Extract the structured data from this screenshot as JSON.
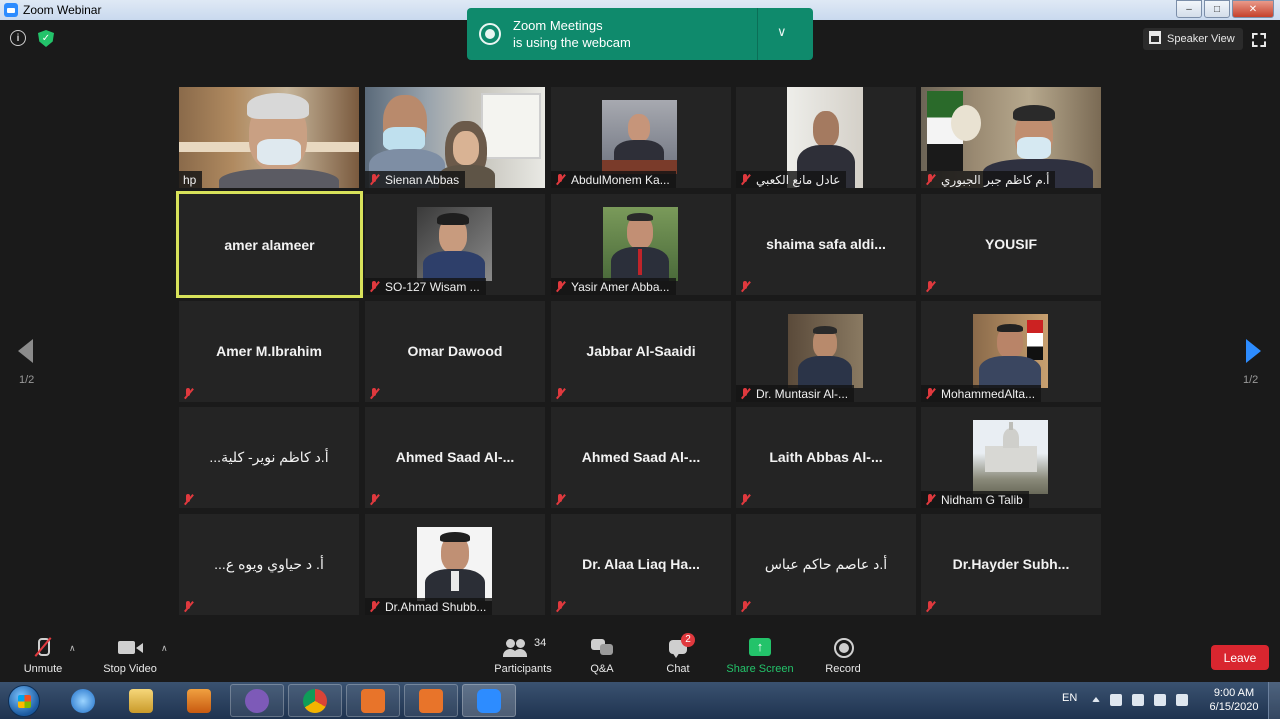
{
  "window": {
    "title": "Zoom Webinar"
  },
  "notification": {
    "line1": "Zoom Meetings",
    "line2": "is using the webcam"
  },
  "view": {
    "speaker_view_label": "Speaker View"
  },
  "paging": {
    "left": "1/2",
    "right": "1/2"
  },
  "tiles": [
    {
      "label": "hp",
      "muted": false,
      "video": true
    },
    {
      "label": "Sienan Abbas",
      "muted": true,
      "video": true
    },
    {
      "label": "AbdulMonem Ka...",
      "muted": true,
      "video": true
    },
    {
      "label": "عادل مانع الكعبي",
      "muted": true,
      "video": true
    },
    {
      "label": "أ.م كاظم جبر الجبوري",
      "muted": true,
      "video": true
    },
    {
      "name": "amer alameer",
      "muted": false,
      "active": true
    },
    {
      "label": "SO-127 Wisam ...",
      "muted": true,
      "photo": true
    },
    {
      "label": "Yasir Amer Abba...",
      "muted": true,
      "photo": true
    },
    {
      "name": "shaima safa aldi...",
      "muted": true
    },
    {
      "name": "YOUSIF",
      "muted": true
    },
    {
      "name": "Amer M.Ibrahim",
      "muted": true
    },
    {
      "name": "Omar Dawood",
      "muted": true
    },
    {
      "name": "Jabbar Al-Saaidi",
      "muted": true
    },
    {
      "label": "Dr. Muntasir Al-...",
      "muted": true,
      "photo": true
    },
    {
      "label": "MohammedAlta...",
      "muted": true,
      "photo": true
    },
    {
      "name": "أ.د كاظم نوير- كلية...",
      "muted": true
    },
    {
      "name": "Ahmed Saad Al-...",
      "muted": true
    },
    {
      "name": "Ahmed Saad Al-...",
      "muted": true
    },
    {
      "name": "Laith Abbas Al-...",
      "muted": true
    },
    {
      "label": "Nidham G Talib",
      "muted": true,
      "photo": true
    },
    {
      "name": "أ. د حياوي ويوه ع...",
      "muted": true
    },
    {
      "label": "Dr.Ahmad Shubb...",
      "muted": true,
      "photo": true
    },
    {
      "name": "Dr. Alaa Liaq Ha...",
      "muted": true
    },
    {
      "name": "أ.د عاصم حاكم عباس",
      "muted": true
    },
    {
      "name": "Dr.Hayder  Subh...",
      "muted": true
    }
  ],
  "toolbar": {
    "unmute": "Unmute",
    "stop_video": "Stop Video",
    "participants": "Participants",
    "participants_count": "34",
    "qa": "Q&A",
    "chat": "Chat",
    "chat_badge": "2",
    "share_screen": "Share Screen",
    "record": "Record",
    "leave": "Leave"
  },
  "taskbar": {
    "language": "EN",
    "time": "9:00 AM",
    "date": "6/15/2020"
  },
  "colors": {
    "accent_green": "#23c36a",
    "notice_green": "#0f8a6c",
    "leave_red": "#d9262f",
    "mute_red": "#e0393e",
    "active_border": "#d8e25a",
    "page_arrow_blue": "#2d8cff"
  },
  "icons": {
    "info": "info-icon",
    "security": "shield-icon",
    "webcam": "webcam-icon",
    "speaker_view": "grid-icon",
    "fullscreen": "fullscreen-icon",
    "mic_muted": "mic-off-icon"
  }
}
